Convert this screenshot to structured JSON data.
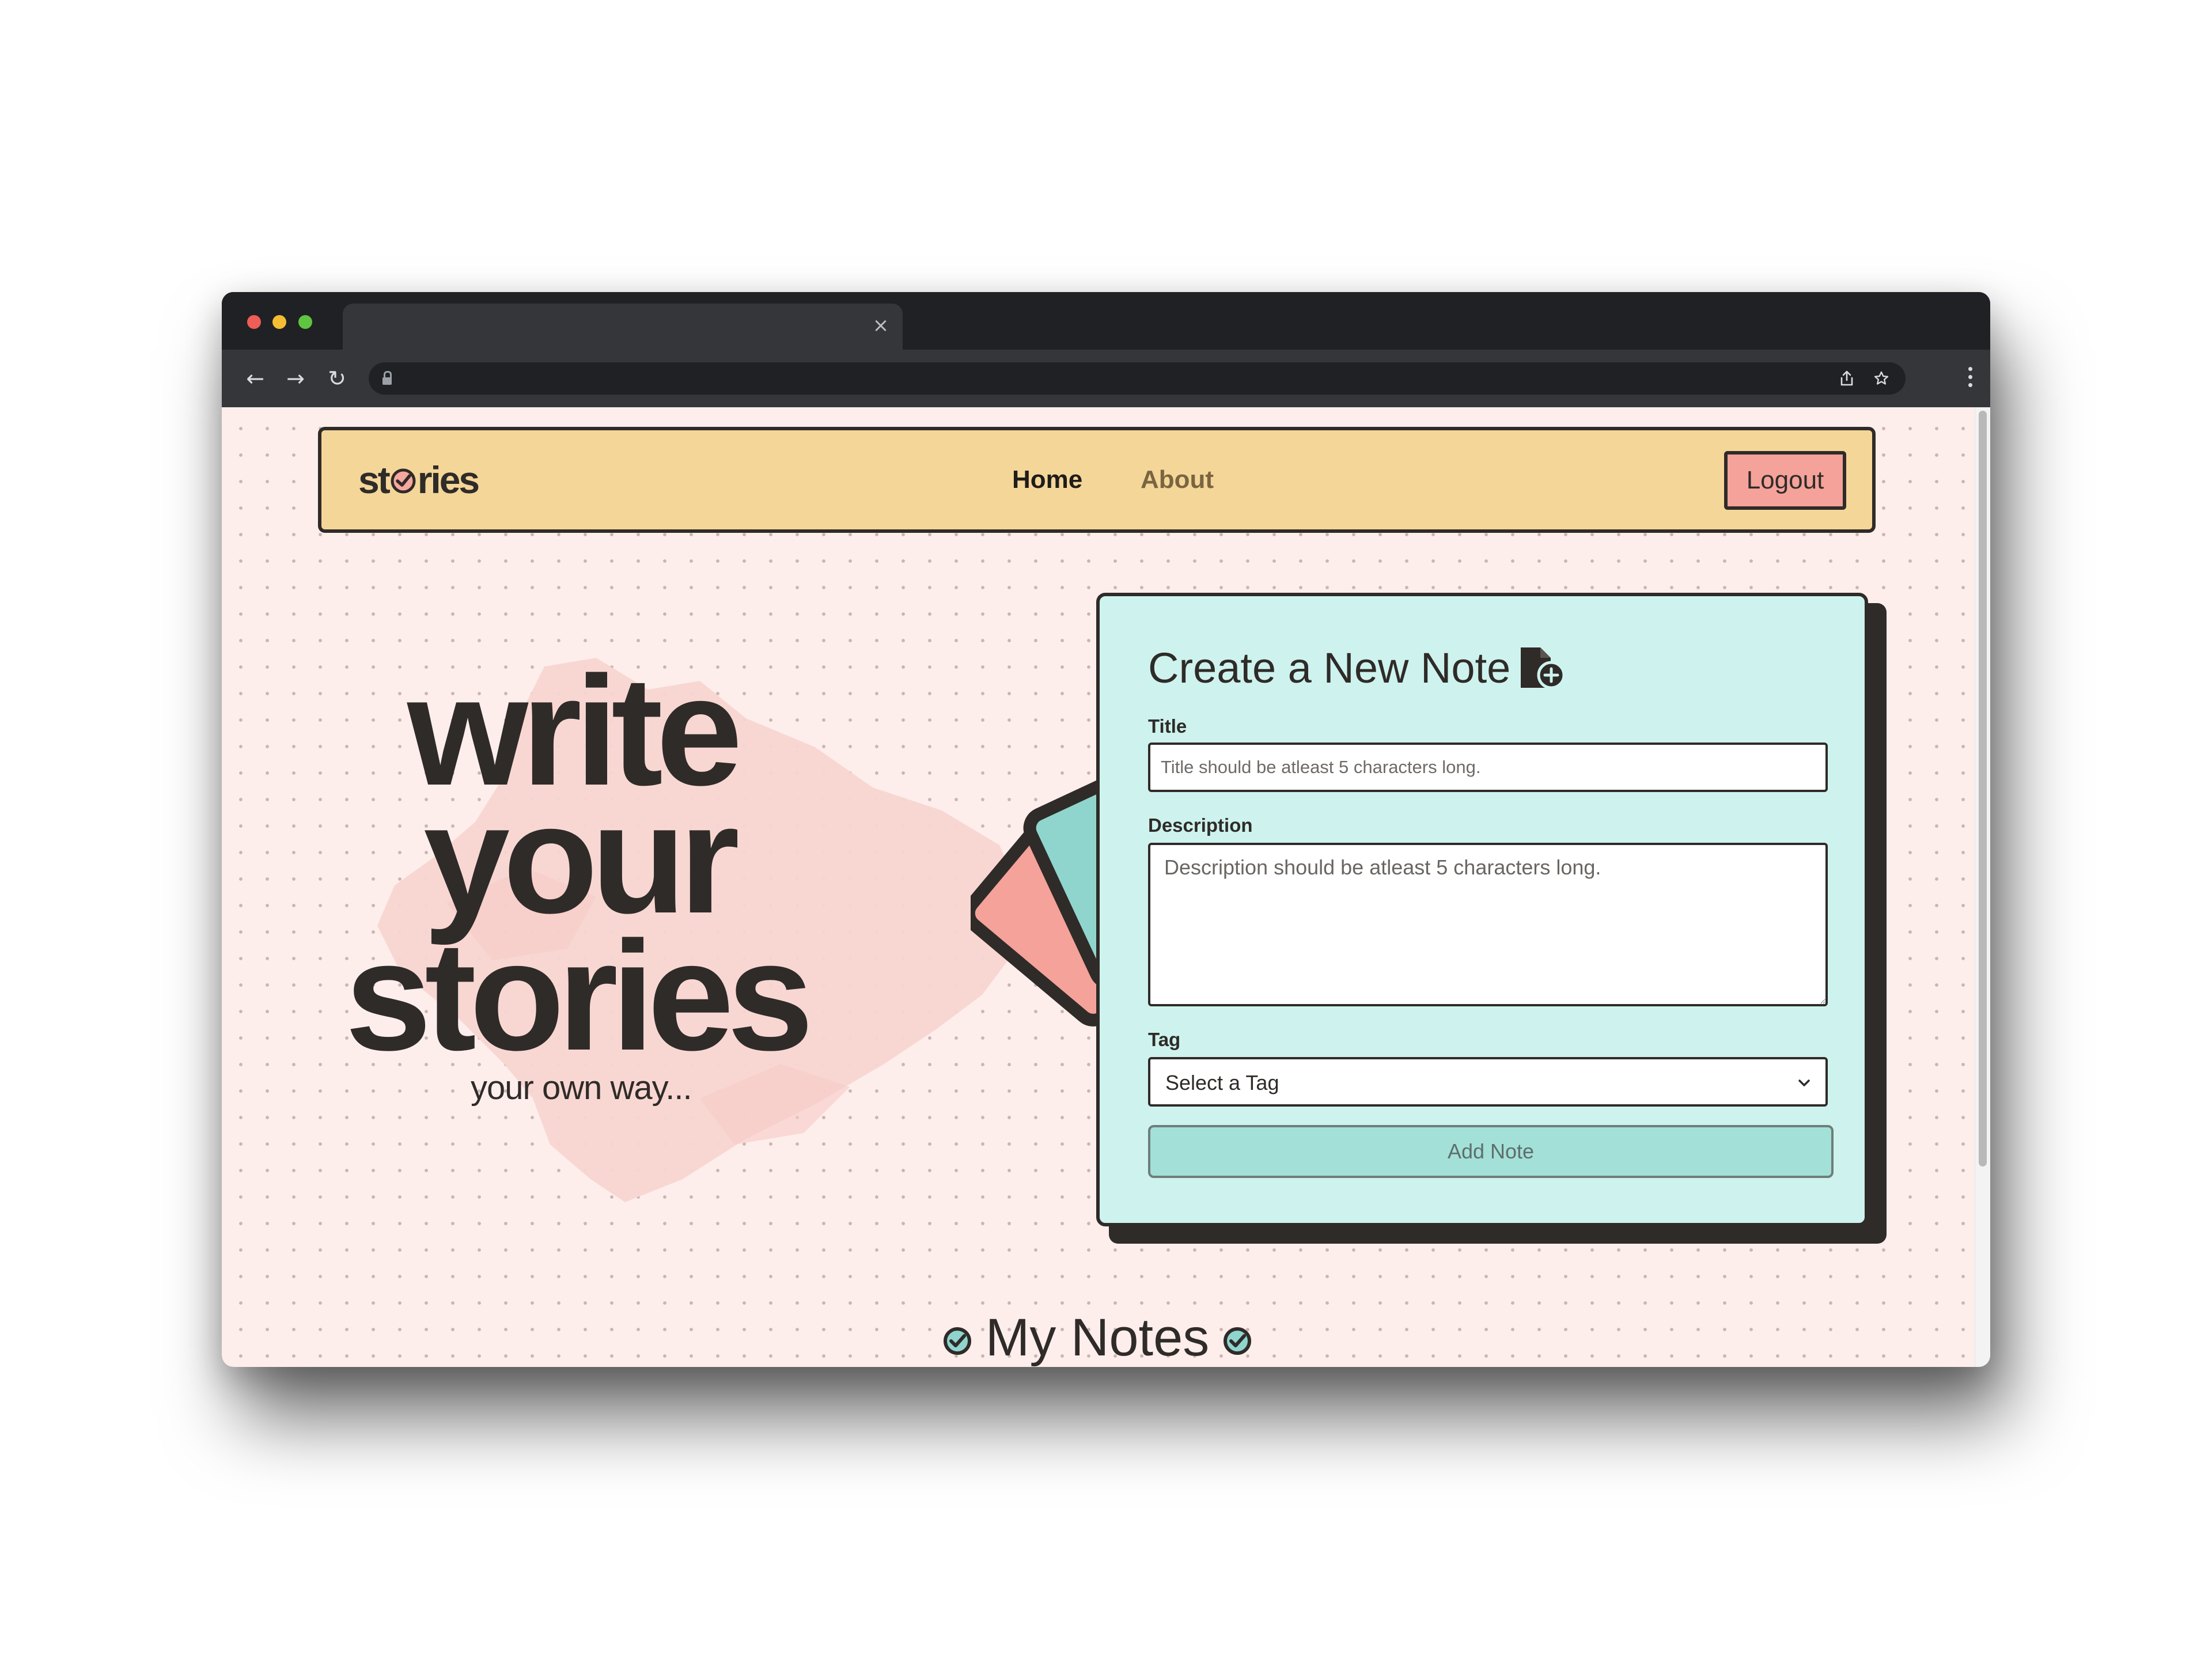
{
  "browser": {
    "tab_close_glyph": "×",
    "nav": {
      "back_glyph": "←",
      "forward_glyph": "→",
      "reload_glyph": "↻"
    },
    "toolbar_icons": [
      "share-icon",
      "star-icon",
      "menu-icon"
    ]
  },
  "navbar": {
    "brand_prefix": "st",
    "brand_suffix": "ries",
    "links": [
      {
        "label": "Home",
        "active": true
      },
      {
        "label": "About",
        "active": false
      }
    ],
    "logout_label": "Logout"
  },
  "hero": {
    "line1": "write",
    "line2": "your",
    "line3": "stories",
    "subtitle": "your own way..."
  },
  "form": {
    "heading": "Create a New Note",
    "title_label": "Title",
    "title_placeholder": "Title should be atleast 5 characters long.",
    "description_label": "Description",
    "description_placeholder": "Description should be atleast 5 characters long.",
    "tag_label": "Tag",
    "tag_selected": "Select a Tag",
    "submit_label": "Add Note"
  },
  "notes_section": {
    "heading": "My Notes"
  },
  "colors": {
    "page_bg": "#fdeeec",
    "navbar_bg": "#f4d698",
    "form_bg": "#cef3ee",
    "logout_bg": "#f4a29a",
    "accent_teal": "#8fd5cd",
    "accent_yellow": "#f4d698",
    "accent_pink": "#f6a79e",
    "ink": "#2f2b28"
  }
}
